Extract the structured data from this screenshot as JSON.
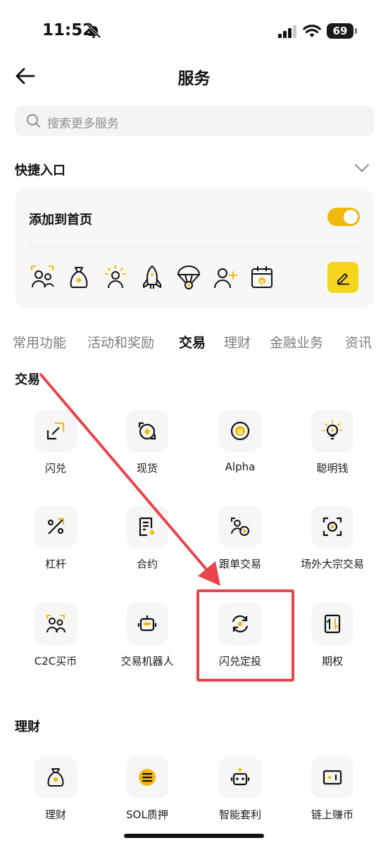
{
  "status_bar": {
    "time": "11:52",
    "battery": "69"
  },
  "header": {
    "title": "服务"
  },
  "search": {
    "placeholder": "搜索更多服务"
  },
  "quick_entry": {
    "title": "快捷入口",
    "add_to_home_label": "添加到首页",
    "toggle_on": true,
    "icons": [
      "users-icon",
      "money-bag-icon",
      "smart-money-icon",
      "rocket-icon",
      "parachute-icon",
      "add-user-icon",
      "calendar-alpha-icon"
    ]
  },
  "tabs": [
    "常用功能",
    "活动和奖励",
    "交易",
    "理财",
    "金融业务",
    "资讯"
  ],
  "active_tab": "交易",
  "sections": {
    "trade": {
      "title": "交易",
      "items": [
        {
          "label": "闪兑",
          "icon": "convert-icon"
        },
        {
          "label": "现货",
          "icon": "spot-icon"
        },
        {
          "label": "Alpha",
          "icon": "alpha-icon"
        },
        {
          "label": "聪明钱",
          "icon": "lightbulb-icon"
        },
        {
          "label": "杠杆",
          "icon": "margin-icon"
        },
        {
          "label": "合约",
          "icon": "futures-icon"
        },
        {
          "label": "跟单交易",
          "icon": "copy-trading-icon"
        },
        {
          "label": "场外大宗交易",
          "icon": "otc-icon"
        },
        {
          "label": "C2C买币",
          "icon": "c2c-icon"
        },
        {
          "label": "交易机器人",
          "icon": "bot-icon"
        },
        {
          "label": "闪兑定投",
          "icon": "recurring-convert-icon"
        },
        {
          "label": "期权",
          "icon": "options-icon"
        }
      ]
    },
    "earn": {
      "title": "理财",
      "items": [
        {
          "label": "理财",
          "icon": "earn-bag-icon"
        },
        {
          "label": "SOL质押",
          "icon": "sol-staking-icon"
        },
        {
          "label": "智能套利",
          "icon": "arbitrage-bot-icon"
        },
        {
          "label": "链上赚币",
          "icon": "onchain-earn-icon"
        }
      ]
    }
  },
  "colors": {
    "accent": "#f0b90b",
    "annotation": "#e8454b"
  }
}
